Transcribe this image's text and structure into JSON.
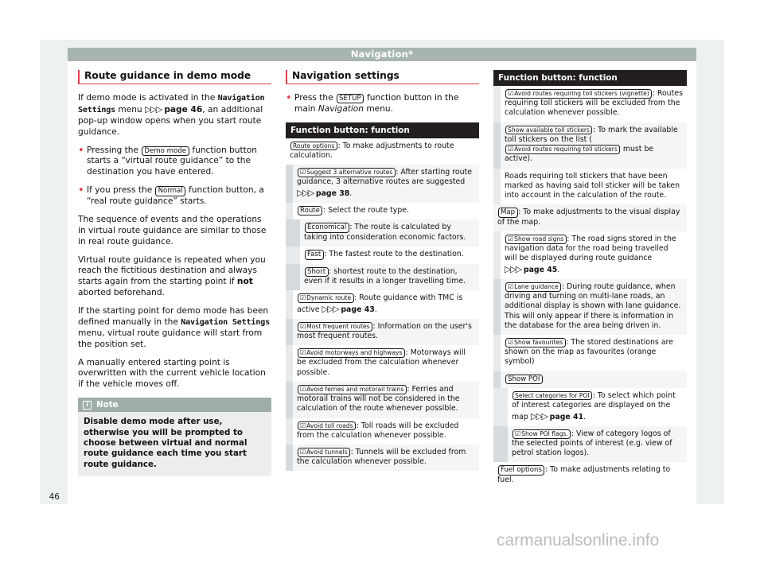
{
  "runhead": {
    "title": "Navigation*"
  },
  "folio": {
    "page": "46"
  },
  "watermark": {
    "text": "carmanualsonline.info"
  },
  "left_column": {
    "heading": "Route guidance in demo mode",
    "p1_a": "If demo mode is activated in the ",
    "p1_mono": "Navigation Settings",
    "p1_b": " menu ",
    "p1_ref": "page 46",
    "p1_c": ", an additional pop-up window opens when you start route guidance.",
    "b1_a": "Pressing the ",
    "b1_btn": "Demo mode",
    "b1_b": " function button starts a “virtual route guidance” to the destination you have entered.",
    "b2_a": "If you press the ",
    "b2_btn": "Normal",
    "b2_b": " function button, a “real route guidance” starts.",
    "p2": "The sequence of events and the operations in virtual route guidance are similar to those in real route guidance.",
    "p3_a": "Virtual route guidance is repeated when you reach the fictitious destination and always starts again from the starting point if ",
    "p3_bold": "not",
    "p3_b": " aborted beforehand.",
    "p4_a": "If the starting point for demo mode has been defined manually in the ",
    "p4_mono": "Navigation Settings",
    "p4_b": " menu, virtual route guidance will start from the position set.",
    "p5": "A manually entered starting point is overwritten with the current vehicle location if the vehicle moves off.",
    "note_title": "Note",
    "note_body": "Disable demo mode after use, otherwise you will be prompted to choose between virtual and normal route guidance each time you start route guidance."
  },
  "middle_column": {
    "heading": "Navigation settings",
    "bullet_a": "Press the ",
    "bullet_btn": "SETUP",
    "bullet_b": " function button in the main ",
    "bullet_italic": "Navigation",
    "bullet_c": " menu.",
    "table_header": "Function button: function",
    "rows": [
      {
        "indent": 0,
        "shade": false,
        "btn": "Route options",
        "check": false,
        "text": ": To make adjustments to route calculation."
      },
      {
        "indent": 1,
        "shade": true,
        "btn": "Suggest 3 alternative routes",
        "check": true,
        "text": ": After starting route guidance, 3 alternative routes are suggested ",
        "ref": "page 38",
        "after": "."
      },
      {
        "indent": 1,
        "shade": false,
        "btn": "Route",
        "check": false,
        "text": ": Select the route type."
      },
      {
        "indent": 2,
        "shade": true,
        "btn": "Economical",
        "check": false,
        "text": ": The route is calculated by taking into consideration economic factors."
      },
      {
        "indent": 2,
        "shade": false,
        "btn": "Fast",
        "check": false,
        "text": ": The fastest route to the destination."
      },
      {
        "indent": 2,
        "shade": true,
        "btn": "Short",
        "check": false,
        "text": ": shortest route to the destination, even if it results in a longer travelling time."
      },
      {
        "indent": 1,
        "shade": false,
        "btn": "Dynamic route",
        "check": true,
        "text": ": Route guidance with TMC is active ",
        "ref": "page 43",
        "after": "."
      },
      {
        "indent": 1,
        "shade": true,
        "btn": "Most frequent routes",
        "check": true,
        "text": ": Information on the user's most frequent routes."
      },
      {
        "indent": 1,
        "shade": false,
        "btn": "Avoid motorways and highways",
        "check": true,
        "text": ": Motorways will be excluded from the calculation whenever possible."
      },
      {
        "indent": 1,
        "shade": true,
        "btn": "Avoid ferries and motorail trains",
        "check": true,
        "text": ": Ferries and motorail trains will not be considered in the calculation of the route whenever possible."
      },
      {
        "indent": 1,
        "shade": false,
        "btn": "Avoid toll roads",
        "check": true,
        "text": ": Toll roads will be excluded from the calculation whenever possible."
      },
      {
        "indent": 1,
        "shade": true,
        "btn": "Avoid tunnels",
        "check": true,
        "text": ": Tunnels will be excluded from the calculation whenever possible."
      }
    ]
  },
  "right_column": {
    "table_header": "Function button: function",
    "rows": [
      {
        "indent": 1,
        "shade": false,
        "btn": "Avoid routes requiring toll stickers (vignette)",
        "check": true,
        "text": ": Routes requiring toll stickers will be excluded from the calculation whenever possible."
      },
      {
        "indent": 1,
        "shade": true,
        "btn": "Show available toll stickers",
        "check": false,
        "text": ": To mark the available toll stickers on the list (",
        "btn2": "Avoid routes requiring toll stickers",
        "check2": true,
        "text2": " must be active)."
      },
      {
        "indent": 1,
        "shade": false,
        "text": "Roads requiring toll stickers that have been marked as having said toll sticker will be taken into account in the calculation of the route."
      },
      {
        "indent": 0,
        "shade": true,
        "btn": "Map",
        "check": false,
        "text": ": To make adjustments to the visual display of the map."
      },
      {
        "indent": 1,
        "shade": false,
        "btn": "Show road signs",
        "check": true,
        "text": ": The road signs stored in the navigation data for the road being travelled will be displayed during route guidance ",
        "ref": "page 45",
        "after": "."
      },
      {
        "indent": 1,
        "shade": true,
        "btn": "Lane guidance",
        "check": true,
        "text": ": During route guidance, when driving and turning on multi-lane roads, an additional display is shown with lane guidance. This will only appear if there is information in the database for the area being driven in."
      },
      {
        "indent": 1,
        "shade": false,
        "btn": "Show favourites",
        "check": true,
        "text": ": The stored destinations are shown on the map as favourites (orange symbol)"
      },
      {
        "indent": 1,
        "shade": true,
        "btn": "Show POI",
        "check": false,
        "text": ""
      },
      {
        "indent": 2,
        "shade": false,
        "btn": "Select categories for POI",
        "check": false,
        "text": ": To select which point of interest categories are displayed on the map ",
        "ref": "page 41",
        "after": "."
      },
      {
        "indent": 2,
        "shade": true,
        "btn": "Show POI flags.",
        "check": true,
        "text": ": View of category logos of the selected points of interest (e.g. view of petrol station logos)."
      },
      {
        "indent": 0,
        "shade": false,
        "btn": "Fuel options",
        "check": false,
        "text": ": To make adjustments relating to fuel."
      }
    ]
  },
  "colors": {
    "accent_red": "#e8394f",
    "runhead_bg": "#a8b4b2",
    "table_header_bg": "#231f20",
    "note_header_bg": "#9fada9",
    "sheet_bg": "#eef1f2"
  }
}
